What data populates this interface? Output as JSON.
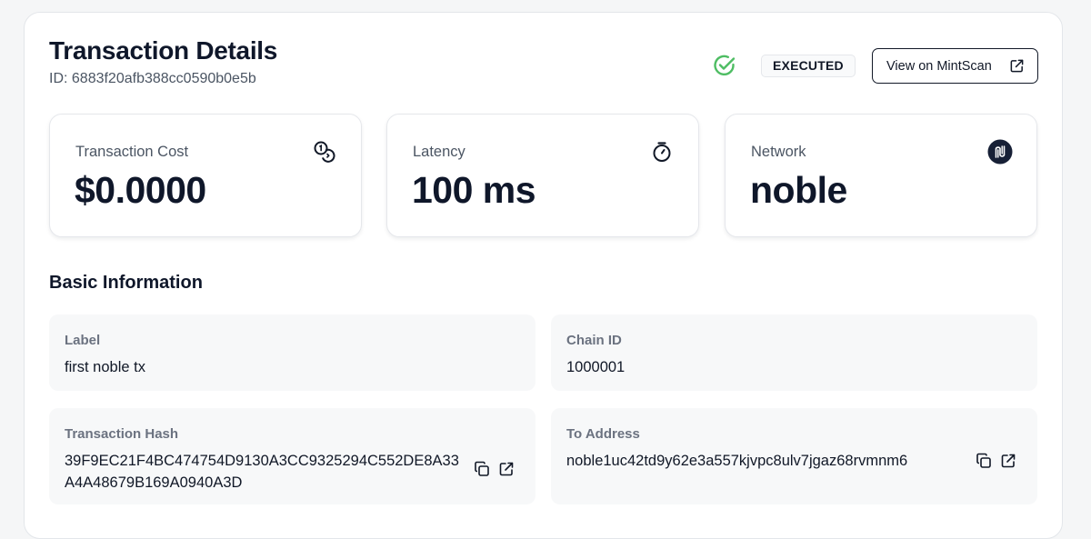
{
  "header": {
    "title": "Transaction Details",
    "id_text": "ID: 6883f20afb388cc0590b0e5b",
    "status": "EXECUTED",
    "status_icon": "check-circle-icon",
    "status_color": "#4ebd63",
    "mint_button_label": "View on MintScan"
  },
  "stats": [
    {
      "label": "Transaction Cost",
      "value": "$0.0000",
      "icon": "coins-icon"
    },
    {
      "label": "Latency",
      "value": "100 ms",
      "icon": "stopwatch-icon"
    },
    {
      "label": "Network",
      "value": "noble",
      "icon": "noble-logo-icon"
    }
  ],
  "basic_info": {
    "title": "Basic Information",
    "label": {
      "label": "Label",
      "value": "first noble tx"
    },
    "chain_id": {
      "label": "Chain ID",
      "value": "1000001"
    },
    "tx_hash": {
      "label": "Transaction Hash",
      "value": "39F9EC21F4BC474754D9130A3CC9325294C552DE8A33A4A48679B169A0940A3D"
    },
    "to_address": {
      "label": "To Address",
      "value": "noble1uc42td9y62e3a557kjvpc8ulv7jgaz68rvmnm6"
    }
  },
  "colors": {
    "accent_dark": "#0f172a",
    "muted": "#6b7280",
    "field_bg": "#f7f8f9"
  }
}
